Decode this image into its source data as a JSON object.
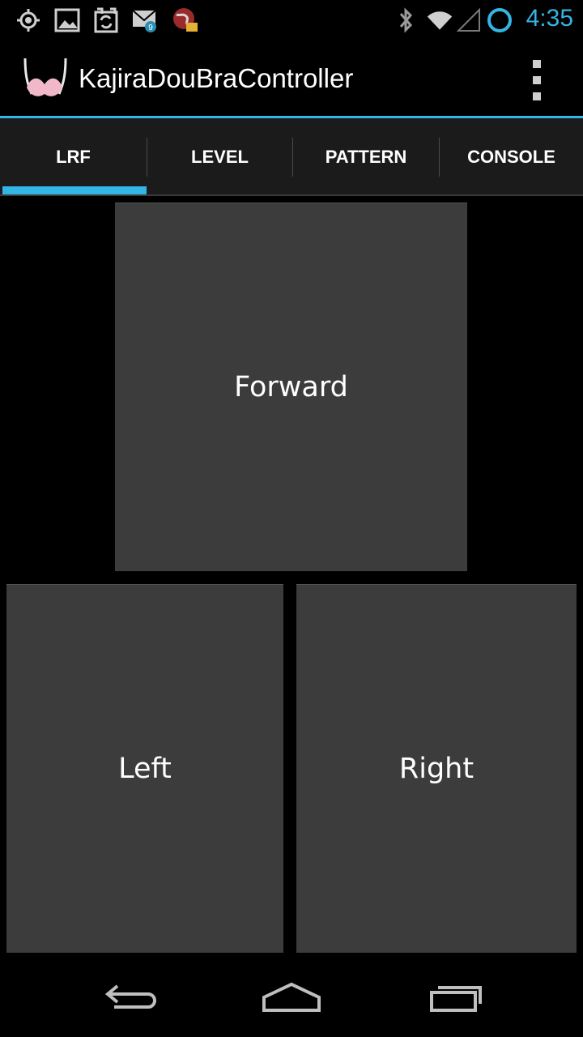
{
  "status_bar": {
    "time": "4:35",
    "icons": [
      "gps-icon",
      "image-icon",
      "sync-icon",
      "mail-icon",
      "browser-icon",
      "bluetooth-icon",
      "wifi-icon",
      "signal-icon",
      "ring-icon"
    ],
    "mail_badge": "9"
  },
  "action_bar": {
    "app_title": "KajiraDouBraController"
  },
  "tabs": [
    {
      "label": "LRF",
      "selected": true
    },
    {
      "label": "LEVEL",
      "selected": false
    },
    {
      "label": "PATTERN",
      "selected": false
    },
    {
      "label": "CONSOLE",
      "selected": false
    }
  ],
  "controls": {
    "forward_label": "Forward",
    "left_label": "Left",
    "right_label": "Right"
  },
  "colors": {
    "accent": "#33b5e5",
    "button_bg": "#3c3c3c"
  }
}
